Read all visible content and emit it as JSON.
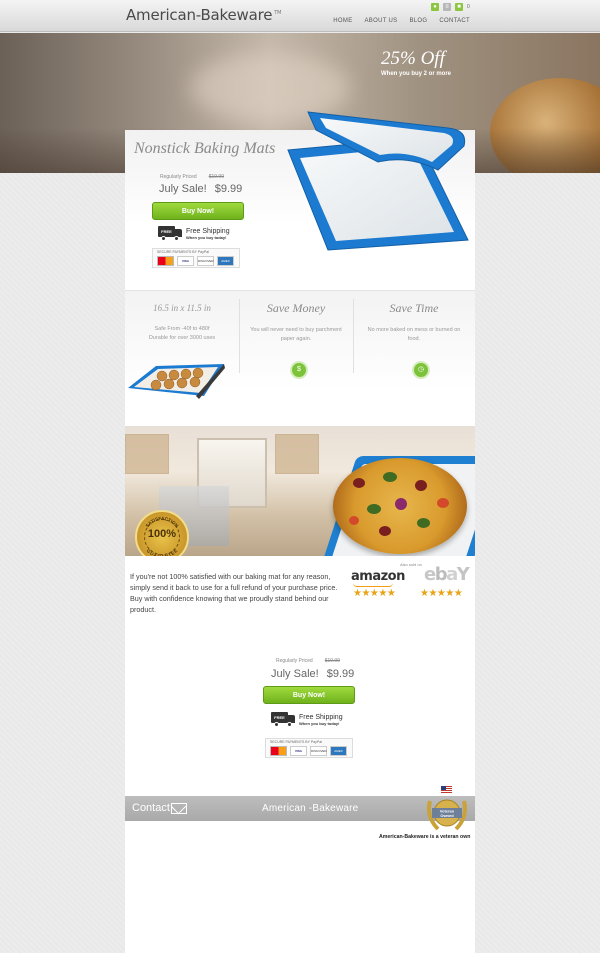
{
  "header": {
    "logo": "American-Bakeware",
    "logo_tm": "TM",
    "nav": [
      "HOME",
      "ABOUT US",
      "BLOG",
      "CONTACT"
    ],
    "cart_count": "0"
  },
  "hero": {
    "promo_title": "25% Off",
    "promo_sub": "When you buy 2 or more"
  },
  "product": {
    "title": "Nonstick Baking Mats",
    "regular_label": "Regularly Priced",
    "regular_price": "$19.99",
    "sale_label": "July Sale!",
    "sale_price": "$9.99",
    "buy_label": "Buy Now!",
    "truck_label": "FREE",
    "ship_title": "Free Shipping",
    "ship_sub": "When you buy today!",
    "secure_label": "SECURE PAYMENTS BY PayPal",
    "cards": [
      "MC",
      "VISA",
      "DISCOVER",
      "AMEX"
    ]
  },
  "features": {
    "size_title": "16.5 in x 11.5 in",
    "size_line1": "Safe From -40f to 480f",
    "size_line2": "Durable for over 3000 uses",
    "money_title": "Save Money",
    "money_text": "You will never need to buy parchment paper again.",
    "money_icon": "$",
    "time_title": "Save Time",
    "time_text": "No more baked on mess or burned on food."
  },
  "guarantee": {
    "seal_pct": "100%",
    "seal_top": "SATISFACTION",
    "seal_bottom": "GUARANTEE",
    "text": "If you're not 100% satisfied with our baking mat for any reason, simply send it back to use for a full refund of your purchase price. Buy with confidence knowing that we proudly stand behind our product.",
    "sold_label": "Also sold on",
    "amazon": "amazon",
    "ebay_e": "e",
    "ebay_b": "b",
    "ebay_a": "a",
    "ebay_y": "Y",
    "stars": "★★★★★"
  },
  "buy_again": {
    "regular_label": "Regularly Priced",
    "regular_price": "$19.99",
    "sale_label": "July Sale!",
    "sale_price": "$9.99",
    "buy_label": "Buy Now!",
    "truck_label": "FREE",
    "ship_title": "Free Shipping",
    "ship_sub": "When you buy today!",
    "secure_label": "SECURE PAYMENTS BY PayPal",
    "cards": [
      "MC",
      "VISA",
      "DISCOVER",
      "AMEX"
    ]
  },
  "footer": {
    "contact": "Contact",
    "brand": "American -Bakeware",
    "badge_line1": "Veteran",
    "badge_line2": "Owned",
    "caption": "American-Bakeware is a veteran own"
  },
  "colors": {
    "accent_green": "#7cc33a",
    "mat_blue": "#1f7fd0"
  }
}
